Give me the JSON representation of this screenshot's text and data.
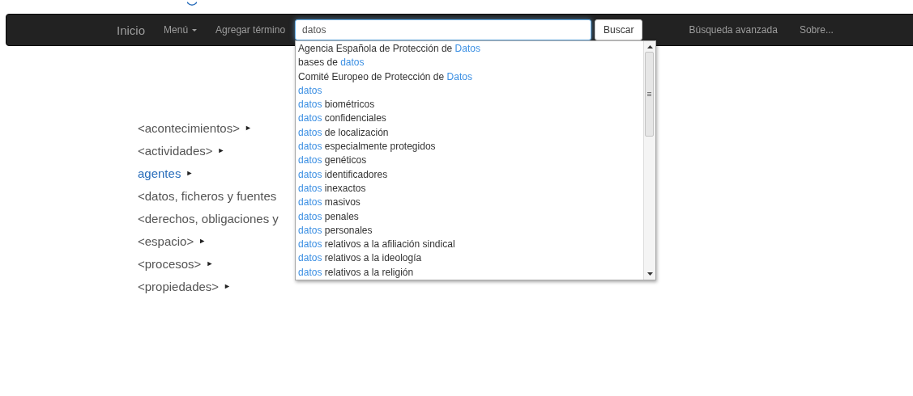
{
  "navbar": {
    "brand": "Inicio",
    "menu": "Menú",
    "add_term": "Agregar término",
    "search": {
      "value": "datos",
      "button": "Buscar"
    },
    "links": [
      "Búsqueda avanzada",
      "Sobre..."
    ]
  },
  "suggestions": [
    {
      "parts": [
        {
          "text": "Agencia Española de Protección de ",
          "match": false
        },
        {
          "text": "Datos",
          "match": true
        }
      ]
    },
    {
      "parts": [
        {
          "text": "bases de ",
          "match": false
        },
        {
          "text": "datos",
          "match": true
        }
      ]
    },
    {
      "parts": [
        {
          "text": "Comité Europeo de Protección de ",
          "match": false
        },
        {
          "text": "Datos",
          "match": true
        }
      ]
    },
    {
      "parts": [
        {
          "text": "datos",
          "match": true
        }
      ]
    },
    {
      "parts": [
        {
          "text": "datos",
          "match": true
        },
        {
          "text": " biométricos",
          "match": false
        }
      ]
    },
    {
      "parts": [
        {
          "text": "datos",
          "match": true
        },
        {
          "text": " confidenciales",
          "match": false
        }
      ]
    },
    {
      "parts": [
        {
          "text": "datos",
          "match": true
        },
        {
          "text": " de localización",
          "match": false
        }
      ]
    },
    {
      "parts": [
        {
          "text": "datos",
          "match": true
        },
        {
          "text": " especialmente protegidos",
          "match": false
        }
      ]
    },
    {
      "parts": [
        {
          "text": "datos",
          "match": true
        },
        {
          "text": " genéticos",
          "match": false
        }
      ]
    },
    {
      "parts": [
        {
          "text": "datos",
          "match": true
        },
        {
          "text": " identificadores",
          "match": false
        }
      ]
    },
    {
      "parts": [
        {
          "text": "datos",
          "match": true
        },
        {
          "text": " inexactos",
          "match": false
        }
      ]
    },
    {
      "parts": [
        {
          "text": "datos",
          "match": true
        },
        {
          "text": " masivos",
          "match": false
        }
      ]
    },
    {
      "parts": [
        {
          "text": "datos",
          "match": true
        },
        {
          "text": " penales",
          "match": false
        }
      ]
    },
    {
      "parts": [
        {
          "text": "datos",
          "match": true
        },
        {
          "text": " personales",
          "match": false
        }
      ]
    },
    {
      "parts": [
        {
          "text": "datos",
          "match": true
        },
        {
          "text": " relativos a la afiliación sindical",
          "match": false
        }
      ]
    },
    {
      "parts": [
        {
          "text": "datos",
          "match": true
        },
        {
          "text": " relativos a la ideología",
          "match": false
        }
      ]
    },
    {
      "parts": [
        {
          "text": "datos",
          "match": true
        },
        {
          "text": " relativos a la religión",
          "match": false
        }
      ]
    }
  ],
  "tree": [
    {
      "label": "<acontecimientos>",
      "kind": "group",
      "arrow": "►"
    },
    {
      "label": "<actividades>",
      "kind": "group",
      "arrow": "►"
    },
    {
      "label": "agentes",
      "kind": "link",
      "arrow": "►"
    },
    {
      "label": "<datos, ficheros y fuentes",
      "kind": "group"
    },
    {
      "label": "<derechos, obligaciones y",
      "kind": "group"
    },
    {
      "label": "<espacio>",
      "kind": "group",
      "arrow": "►"
    },
    {
      "label": "<procesos>",
      "kind": "group",
      "arrow": "►"
    },
    {
      "label": "<propiedades>",
      "kind": "group",
      "arrow": "►"
    }
  ]
}
